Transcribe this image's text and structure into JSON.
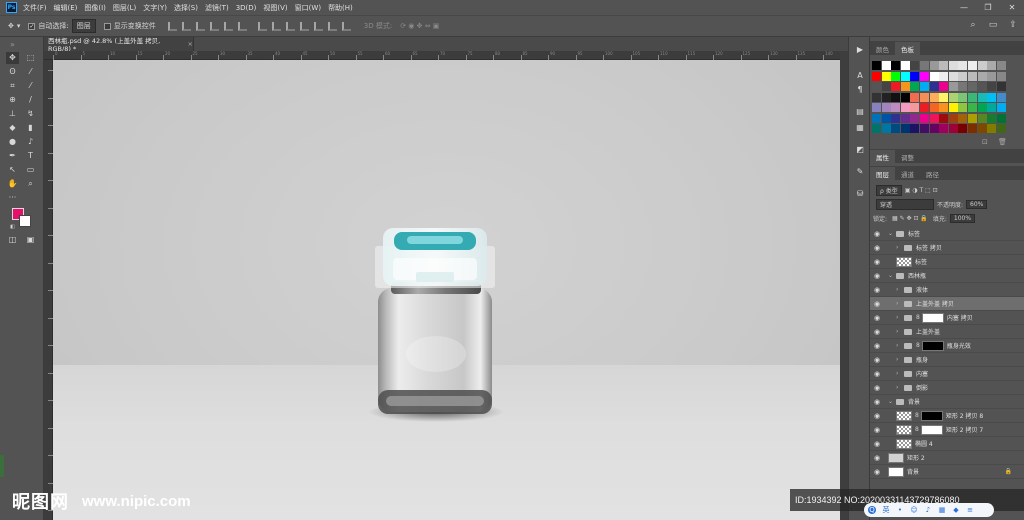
{
  "menubar": {
    "logo": "Ps",
    "items": [
      "文件(F)",
      "编辑(E)",
      "图像(I)",
      "图层(L)",
      "文字(Y)",
      "选择(S)",
      "滤镜(T)",
      "3D(D)",
      "视图(V)",
      "窗口(W)",
      "帮助(H)"
    ]
  },
  "options": {
    "auto_select_label": "自动选择:",
    "auto_select_value": "图层",
    "transform_label": "显示变换控件",
    "mode_3d": "3D 模式:"
  },
  "document": {
    "tab_title": "西林瓶.psd @ 42.8% (上盖外盖 拷贝, RGB/8) *",
    "tab_close": "×"
  },
  "ruler_labels": [
    "0",
    "5",
    "10",
    "15",
    "20",
    "25",
    "30",
    "35",
    "40",
    "45",
    "50",
    "55",
    "60",
    "65",
    "70",
    "75",
    "80",
    "85",
    "90",
    "95",
    "100",
    "105",
    "110",
    "115",
    "120",
    "125",
    "130",
    "135",
    "140"
  ],
  "panels": {
    "color_tab": "颜色",
    "swatches_tab": "色板",
    "properties_tab": "属性",
    "adjust_tab": "调整",
    "layers_tab": "图层",
    "channels_tab": "通道",
    "paths_tab": "路径",
    "filter_kind": "ρ 类型",
    "blend_mode": "穿透",
    "opacity_label": "不透明度:",
    "opacity_value": "60%",
    "lock_label": "锁定:",
    "fill_label": "填充:",
    "fill_value": "100%"
  },
  "layers": [
    {
      "name": "标签",
      "type": "group",
      "indent": 0,
      "open": true
    },
    {
      "name": "标签 拷贝",
      "type": "group",
      "indent": 1
    },
    {
      "name": "标签",
      "type": "layer",
      "indent": 1,
      "thumb": "check"
    },
    {
      "name": "西林瓶",
      "type": "group",
      "indent": 0,
      "open": true
    },
    {
      "name": "液体",
      "type": "group",
      "indent": 1
    },
    {
      "name": "上盖外盖 拷贝",
      "type": "group",
      "indent": 1,
      "selected": true
    },
    {
      "name": "内塞 拷贝",
      "type": "group",
      "indent": 1,
      "mask": "white"
    },
    {
      "name": "上盖外盖",
      "type": "group",
      "indent": 1
    },
    {
      "name": "瓶身光效",
      "type": "group",
      "indent": 1,
      "mask": "black"
    },
    {
      "name": "瓶身",
      "type": "group",
      "indent": 1
    },
    {
      "name": "内塞",
      "type": "group",
      "indent": 1
    },
    {
      "name": "倒影",
      "type": "group",
      "indent": 1
    },
    {
      "name": "背景",
      "type": "group",
      "indent": 0,
      "open": true
    },
    {
      "name": "矩形 2 拷贝 8",
      "type": "layer",
      "indent": 1,
      "thumb": "check",
      "mask": "black"
    },
    {
      "name": "矩形 2 拷贝 7",
      "type": "layer",
      "indent": 1,
      "thumb": "check",
      "mask": "white"
    },
    {
      "name": "椭圆 4",
      "type": "layer",
      "indent": 1,
      "thumb": "check"
    },
    {
      "name": "矩形 2",
      "type": "layer",
      "indent": 0,
      "thumb": "gray"
    },
    {
      "name": "背景",
      "type": "layer",
      "indent": 0,
      "thumb": "white",
      "lock": true
    }
  ],
  "swatch_colors": [
    [
      "#000000",
      "#ffffff",
      "#000000",
      "#ffffff",
      "#444444",
      "#777777",
      "#999999",
      "#bbbbbb",
      "#dddddd",
      "#e5e5e5",
      "#eeeeee",
      "#cccccc",
      "#aaaaaa",
      "#888888"
    ],
    [
      "#ff0000",
      "#ffff00",
      "#00ff00",
      "#00ffff",
      "#0000ff",
      "#ff00ff",
      "#ffffff",
      "#eeeeee",
      "#dddddd",
      "#cccccc",
      "#bbbbbb",
      "#aaaaaa",
      "#999999",
      "#888888"
    ],
    [
      "#555555",
      "#444444",
      "#ed1c24",
      "#f7941d",
      "#00a651",
      "#00aeef",
      "#2e3192",
      "#ec008c",
      "#999999",
      "#777777",
      "#666666",
      "#555555",
      "#444444",
      "#333333"
    ],
    [
      "#333333",
      "#222222",
      "#111111",
      "#000000",
      "#f26c4f",
      "#f68e55",
      "#fbaf5c",
      "#fff467",
      "#acd372",
      "#7cc576",
      "#3bb878",
      "#1abbb4",
      "#00bff3",
      "#438ccb"
    ],
    [
      "#8781bd",
      "#a186be",
      "#bd8cbf",
      "#f49ac1",
      "#f5989d",
      "#ed1c24",
      "#f26522",
      "#f7941d",
      "#fff200",
      "#8dc63f",
      "#39b54a",
      "#00a651",
      "#00a99d",
      "#00aeef"
    ],
    [
      "#0072bc",
      "#0054a6",
      "#2e3192",
      "#662d91",
      "#92278f",
      "#ec008c",
      "#ed145b",
      "#9e0b0f",
      "#a0410d",
      "#a3620a",
      "#aba000",
      "#598527",
      "#197b30",
      "#007236"
    ],
    [
      "#00746b",
      "#0076a3",
      "#004a80",
      "#003471",
      "#1b1464",
      "#440e62",
      "#630460",
      "#9e005d",
      "#9e0039",
      "#790000",
      "#7b2e00",
      "#7d4900",
      "#827b00",
      "#406618"
    ]
  ],
  "watermark": {
    "logo": "昵图网",
    "url": "www.nipic.com",
    "id": "ID:1934392 NO:20200331143729786080"
  },
  "ime": {
    "logo": "Q",
    "mode": "英"
  },
  "icons": {
    "move": "move-icon",
    "marquee": "marquee-icon",
    "lasso": "lasso-icon"
  }
}
